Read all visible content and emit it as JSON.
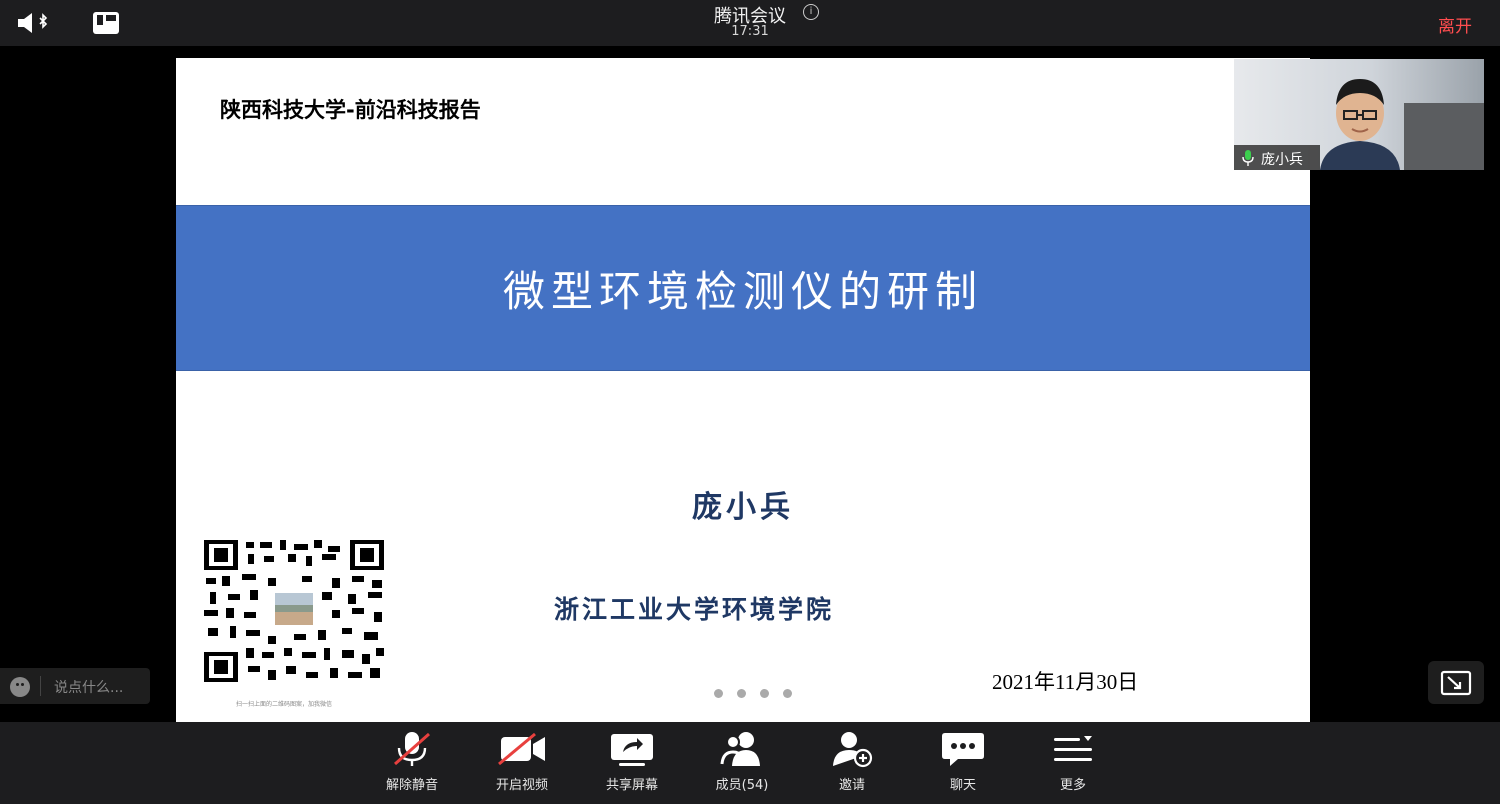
{
  "topbar": {
    "title": "腾讯会议",
    "time": "17:31",
    "leave_label": "离开",
    "info_symbol": "i"
  },
  "slide": {
    "header": "陕西科技大学-前沿科技报告",
    "title": "微型环境检测仪的研制",
    "author": "庞小兵",
    "affiliation": "浙江工业大学环境学院",
    "date": "2021年11月30日",
    "qr_caption": "扫一扫上面的二维码图案，加我微信",
    "band_color": "#4472c4"
  },
  "video": {
    "participant_name": "庞小兵"
  },
  "chat": {
    "placeholder": "说点什么..."
  },
  "toolbar": {
    "unmute": "解除静音",
    "start_video": "开启视频",
    "share_screen": "共享屏幕",
    "members": "成员(54)",
    "invite": "邀请",
    "chat": "聊天",
    "more": "更多"
  }
}
